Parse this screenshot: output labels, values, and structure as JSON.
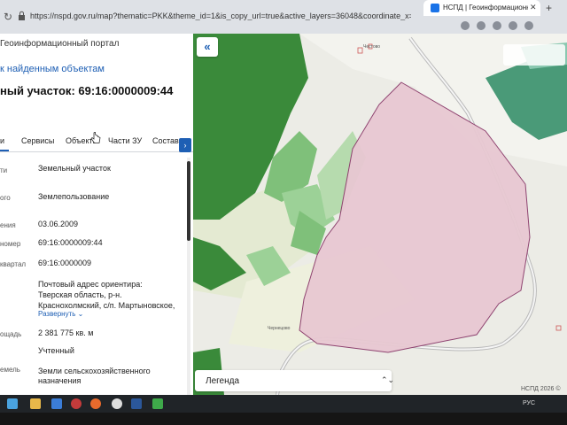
{
  "browser": {
    "url": "https://nspd.gov.ru/map?thematic=PKK&theme_id=1&is_copy_url=true&active_layers=36048&coordinate_x=4159002.92087107528&coordinate_y=8031470.876...",
    "tab_title": "НСПД | Геоинформационный по"
  },
  "panel": {
    "portal_title": "Геоинформационный портал",
    "back_link": "к найденным объектам",
    "parcel_title": "ный участок: 69:16:0000009:44",
    "tabs": [
      "Сервисы",
      "Объекты",
      "Части ЗУ",
      "Состав"
    ],
    "fields": [
      {
        "label": "ти",
        "value": "Земельный участок"
      },
      {
        "label": "ого",
        "value": "Землепользование"
      },
      {
        "label": "ения",
        "value": "03.06.2009"
      },
      {
        "label": "номер",
        "value": "69:16:0000009:44"
      },
      {
        "label": "квартал",
        "value": "69:16:0000009"
      },
      {
        "label": "",
        "value": "Почтовый адрес ориентира:"
      },
      {
        "label": "",
        "value": "Тверская область, р-н."
      },
      {
        "label": "",
        "value": "Краснохолмский, с/п. Мартыновское,"
      },
      {
        "label": "ощадь",
        "value": "2 381 775 кв. м"
      },
      {
        "label": "",
        "value": "Учтенный"
      },
      {
        "label": "емель",
        "value": "Земли сельскохозяйственного"
      },
      {
        "label": "",
        "value": "назначения"
      }
    ],
    "expand_link": "Развернуть"
  },
  "map": {
    "collapse_button": "«",
    "village_1": "Честово",
    "village_2": "Чернецово",
    "legend_label": "Легенда",
    "copyright": "НСПД 2026 ©",
    "colors": {
      "parcel_fill": "#e8c8d2",
      "parcel_stroke": "#8a3a6a",
      "forest_dark": "#3a8a3a",
      "forest_light": "#7fc07a",
      "teal": "#4a9a78"
    }
  },
  "taskbar": {
    "tray_lang": "РУС"
  }
}
